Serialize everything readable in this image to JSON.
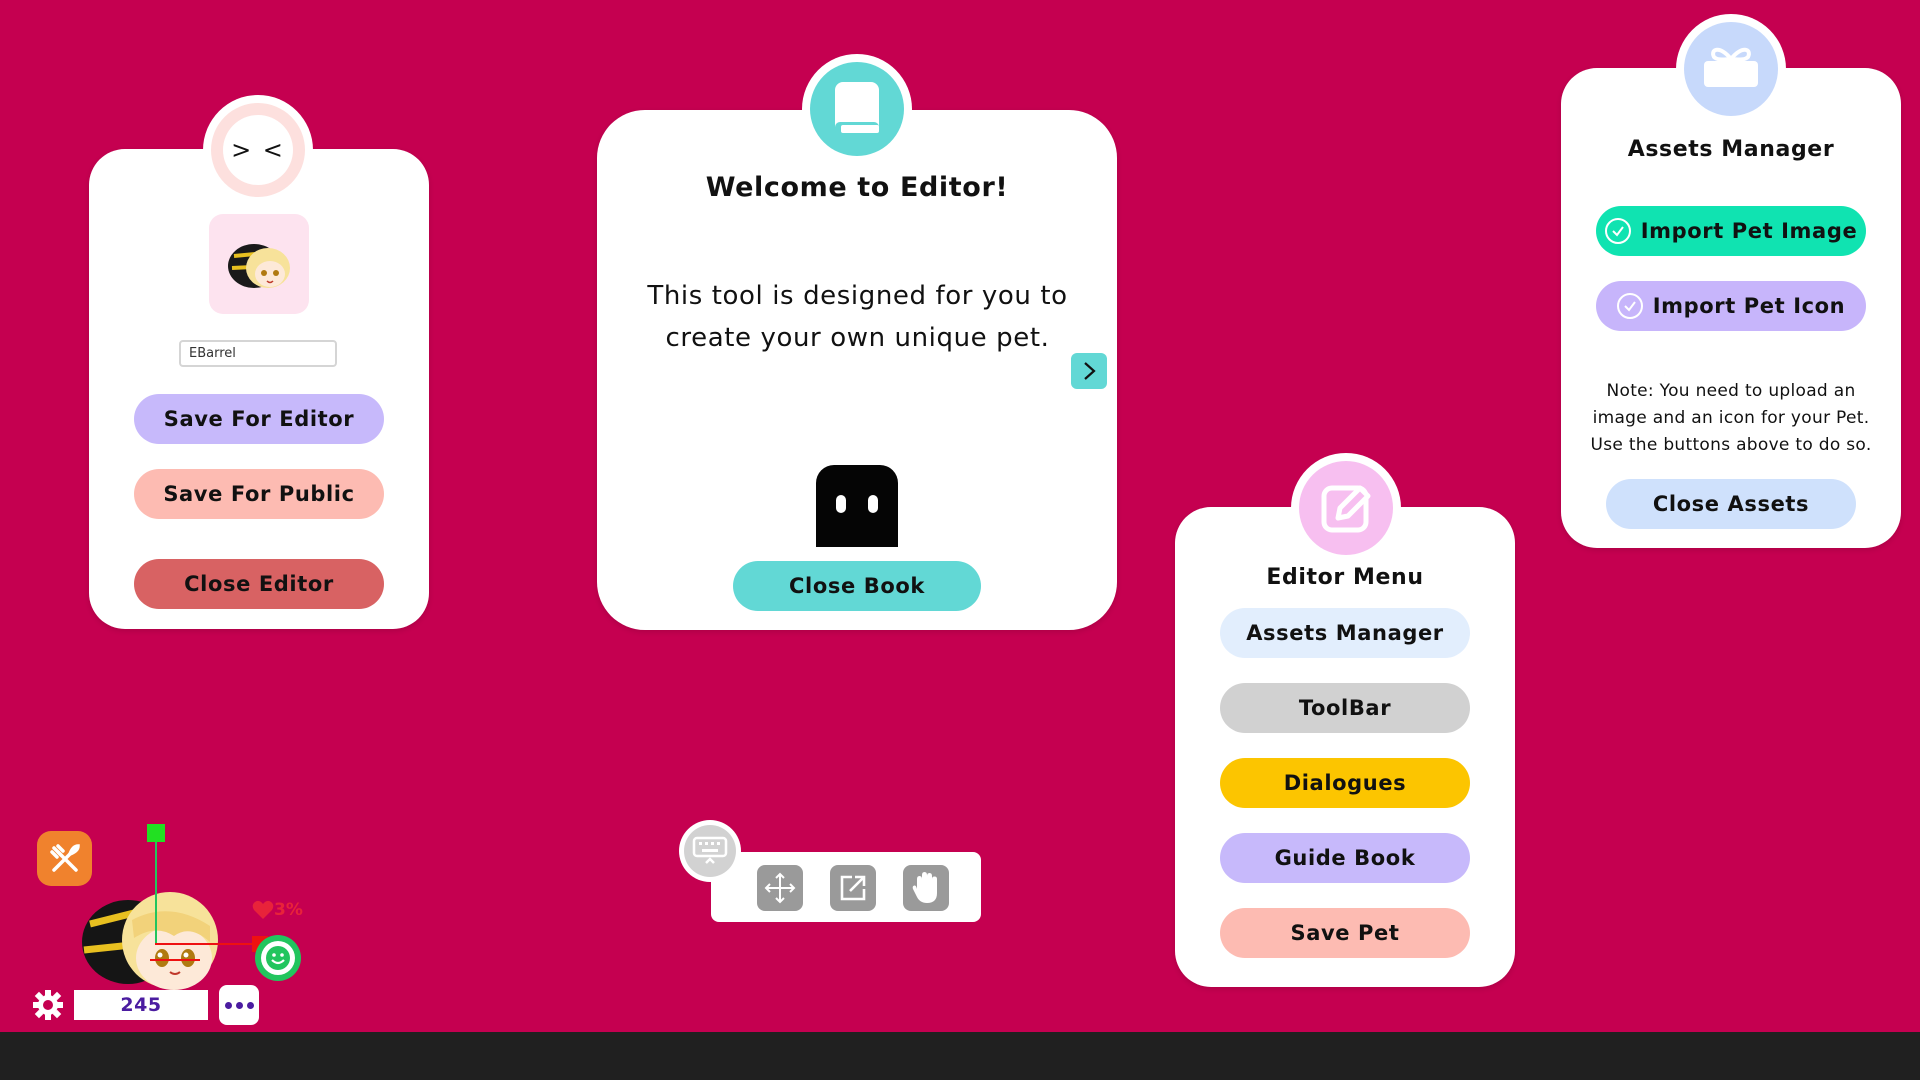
{
  "colors": {
    "background": "#c50050",
    "teal": "#62d8d5",
    "lavender": "#c7b9fb",
    "salmon": "#fdbbb2",
    "red": "#d86263",
    "light_blue": "#e2eefd",
    "gray": "#d1d1d1",
    "yellow": "#fcc500",
    "mint": "#10e3b1",
    "purple_btn": "#c7b5fb",
    "blue_btn": "#cfe1fc"
  },
  "save_panel": {
    "face_text": "> <",
    "icon": "pet-thumbnail",
    "name_value": "EBarrel",
    "save_editor": "Save For Editor",
    "save_public": "Save For Public",
    "close_editor": "Close Editor"
  },
  "welcome_panel": {
    "icon": "book-icon",
    "title": "Welcome to Editor!",
    "body": "This tool is designed for you to create your own unique pet.",
    "close_book": "Close Book"
  },
  "editor_menu": {
    "icon": "edit-icon",
    "title": "Editor Menu",
    "items": [
      "Assets Manager",
      "ToolBar",
      "Dialogues",
      "Guide Book",
      "Save Pet"
    ]
  },
  "assets_panel": {
    "icon": "gift-icon",
    "title": "Assets Manager",
    "import_image": "Import Pet Image",
    "import_icon": "Import Pet Icon",
    "note": "Note: You need to upload an image and an icon for your Pet. Use the buttons above to do so.",
    "close_assets": "Close Assets"
  },
  "toolbar": {
    "icons": [
      "keyboard-icon",
      "move-icon",
      "external-link-icon",
      "hand-icon"
    ]
  },
  "pet_hud": {
    "hp_text": "3%",
    "counter": "245",
    "icons": [
      "food-icon",
      "heart-icon",
      "smile-icon",
      "gear-icon",
      "more-icon"
    ]
  }
}
